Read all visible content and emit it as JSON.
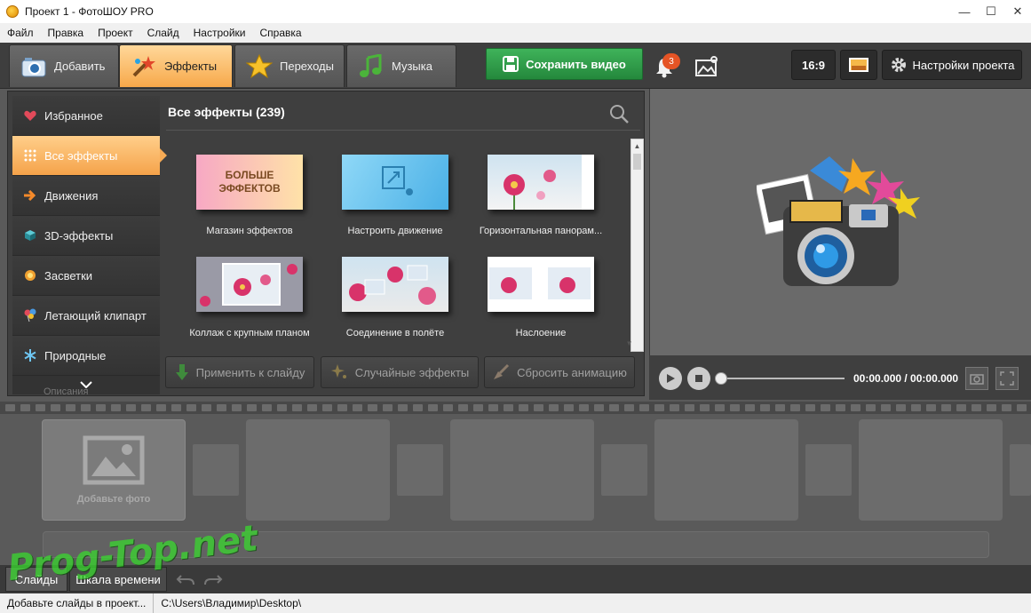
{
  "window": {
    "title": "Проект 1 - ФотоШОУ PRO",
    "min": "—",
    "max": "☐",
    "close": "✕"
  },
  "menu": [
    "Файл",
    "Правка",
    "Проект",
    "Слайд",
    "Настройки",
    "Справка"
  ],
  "tabs": {
    "add": "Добавить",
    "effects": "Эффекты",
    "transitions": "Переходы",
    "music": "Музыка"
  },
  "toolbar": {
    "save_label": "Сохранить видео",
    "notification_count": "3",
    "aspect_ratio": "16:9",
    "settings_label": "Настройки проекта"
  },
  "categories": [
    {
      "label": "Избранное",
      "icon": "heart-icon"
    },
    {
      "label": "Все эффекты",
      "icon": "grid-icon"
    },
    {
      "label": "Движения",
      "icon": "arrow-icon"
    },
    {
      "label": "3D-эффекты",
      "icon": "cube-icon"
    },
    {
      "label": "Засветки",
      "icon": "sun-icon"
    },
    {
      "label": "Летающий клипарт",
      "icon": "balloons-icon"
    },
    {
      "label": "Природные",
      "icon": "snowflake-icon"
    }
  ],
  "categories_more": "Описания",
  "effects": {
    "title": "Все эффекты (239)",
    "shop_thumb_text": "БОЛЬШЕ ЭФФЕКТОВ",
    "items": [
      "Магазин эффектов",
      "Настроить движение",
      "Горизонтальная панорам...",
      "Коллаж с крупным планом",
      "Соединение в полёте",
      "Наслоение"
    ]
  },
  "actions": {
    "apply": "Применить к слайду",
    "random": "Случайные эффекты",
    "reset": "Сбросить анимацию"
  },
  "player": {
    "time": "00:00.000 / 00:00.000"
  },
  "timeline": {
    "add_photo": "Добавьте фото"
  },
  "bottom_tabs": {
    "slides": "Слайды",
    "timeline": "Шкала времени"
  },
  "watermark": "Prog-Top.net",
  "status": {
    "message": "Добавьте слайды в проект...",
    "path": "C:\\Users\\Владимир\\Desktop\\"
  },
  "colors": {
    "accent_orange": "#f7a84a",
    "save_green": "#2e9a47",
    "badge_red": "#e55425"
  }
}
